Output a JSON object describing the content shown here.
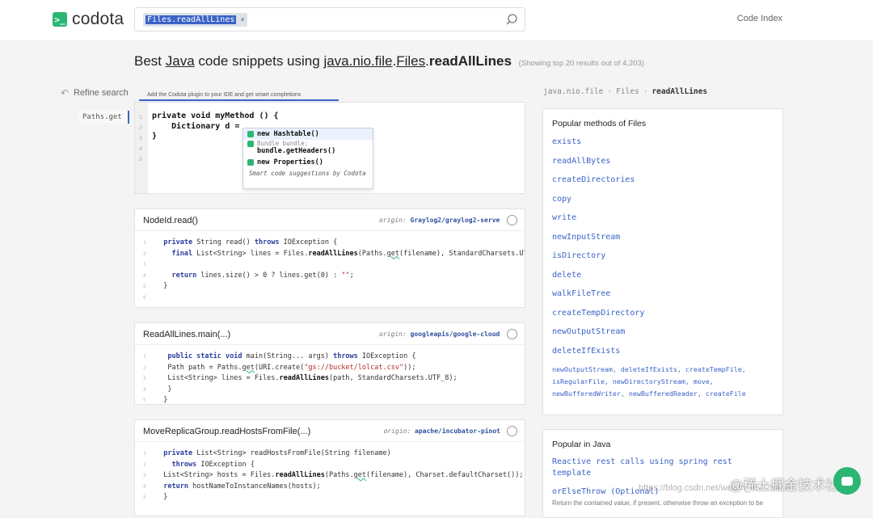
{
  "logo": {
    "mark": ">_",
    "text": "codota"
  },
  "search": {
    "chip": "Files.readAllLines",
    "chip_close": "×"
  },
  "nav": {
    "code_index": "Code Index"
  },
  "headline": {
    "prefix": "Best",
    "lang": "Java",
    "middle": "code snippets using",
    "pkg": "java.nio.file",
    "dot1": ".",
    "cls": "Files",
    "dot2": ".",
    "method": "readAllLines",
    "sub": "(Showing top 20 results out of 4,203)"
  },
  "sidebar": {
    "refine": "Refine search",
    "filter": "Paths.get"
  },
  "editor": {
    "plugin_text": "Add the Codota plugin to your IDE and get smart completions",
    "line_numbers": "1\n2\n3\n4\n5",
    "code": "private void myMethod () {\n    Dictionary d =\n}",
    "suggestions": [
      {
        "sub": "",
        "text": "new Hashtable()"
      },
      {
        "sub": "Bundle bundle;",
        "text": "bundle.getHeaders()"
      },
      {
        "sub": "",
        "text": "new Properties()"
      }
    ],
    "footer": "Smart code suggestions by Codota"
  },
  "snippets": [
    {
      "title": "NodeId.read()",
      "origin_label": "origin:",
      "origin": "Graylog2/graylog2-server"
    },
    {
      "title": "ReadAllLines.main(...)",
      "origin_label": "origin:",
      "origin": "googleapis/google-cloud-java"
    },
    {
      "title": "MoveReplicaGroup.readHostsFromFile(...)",
      "origin_label": "origin:",
      "origin": "apache/incubator-pinot"
    }
  ],
  "breadcrumb": {
    "a": "java.nio.file",
    "sep": "›",
    "b": "Files",
    "c": "readAllLines"
  },
  "popular_methods": {
    "title": "Popular methods of Files",
    "items": [
      "exists",
      "readAllBytes",
      "createDirectories",
      "copy",
      "write",
      "newInputStream",
      "isDirectory",
      "delete",
      "walkFileTree",
      "createTempDirectory",
      "newOutputStream",
      "deleteIfExists"
    ],
    "more": "newOutputStream, deleteIfExists, createTempFile, isRegularFile, newDirectoryStream, move, newBufferedWriter, newBufferedReader, createFile"
  },
  "popular_java": {
    "title": "Popular in Java",
    "item1": "Reactive rest calls using spring rest template",
    "item2": "orElseThrow (Optional)",
    "item2_desc": "Return the contained value, if present, otherwise throw an exception to be"
  },
  "watermark": {
    "small": "https://blog.csdn.net/weixin_45025416",
    "big": "@稀土掘金技术社区"
  },
  "colors": {
    "accent": "#3b63c7",
    "brand": "#2bb673"
  }
}
